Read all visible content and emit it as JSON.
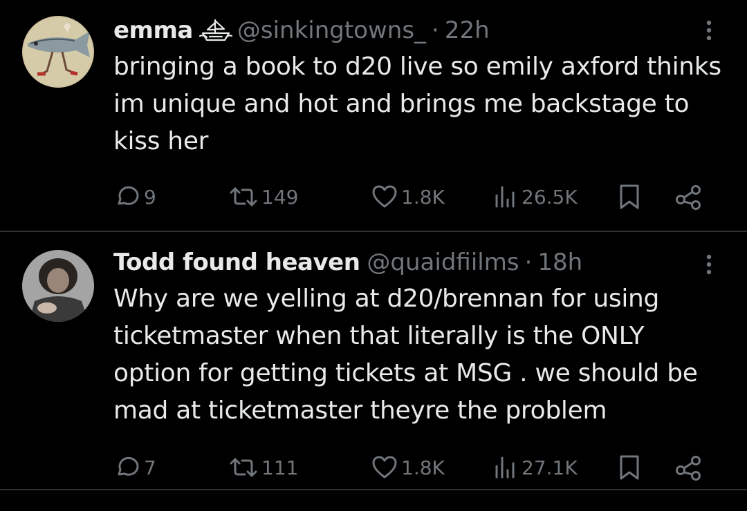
{
  "colors": {
    "background": "#000000",
    "primary_text": "#e7e9ea",
    "secondary_text": "#71767b",
    "divider": "#2f3336"
  },
  "tweets": [
    {
      "display_name": "emma",
      "badge_icon": "ship-icon",
      "handle": "@sinkingtowns_",
      "separator": "·",
      "time": "22h",
      "text": "bringing a book to d20 live so emily axford thinks im unique and hot and brings me backstage to kiss her",
      "replies": "9",
      "reposts": "149",
      "likes": "1.8K",
      "views": "26.5K"
    },
    {
      "display_name": "Todd found heaven",
      "handle": "@quaidfiilms",
      "separator": "·",
      "time": "18h",
      "text": "Why are we yelling at d20/brennan for using ticketmaster when that literally is the ONLY option for getting tickets at MSG . we should be mad at ticketmaster theyre the problem",
      "replies": "7",
      "reposts": "111",
      "likes": "1.8K",
      "views": "27.1K"
    }
  ]
}
